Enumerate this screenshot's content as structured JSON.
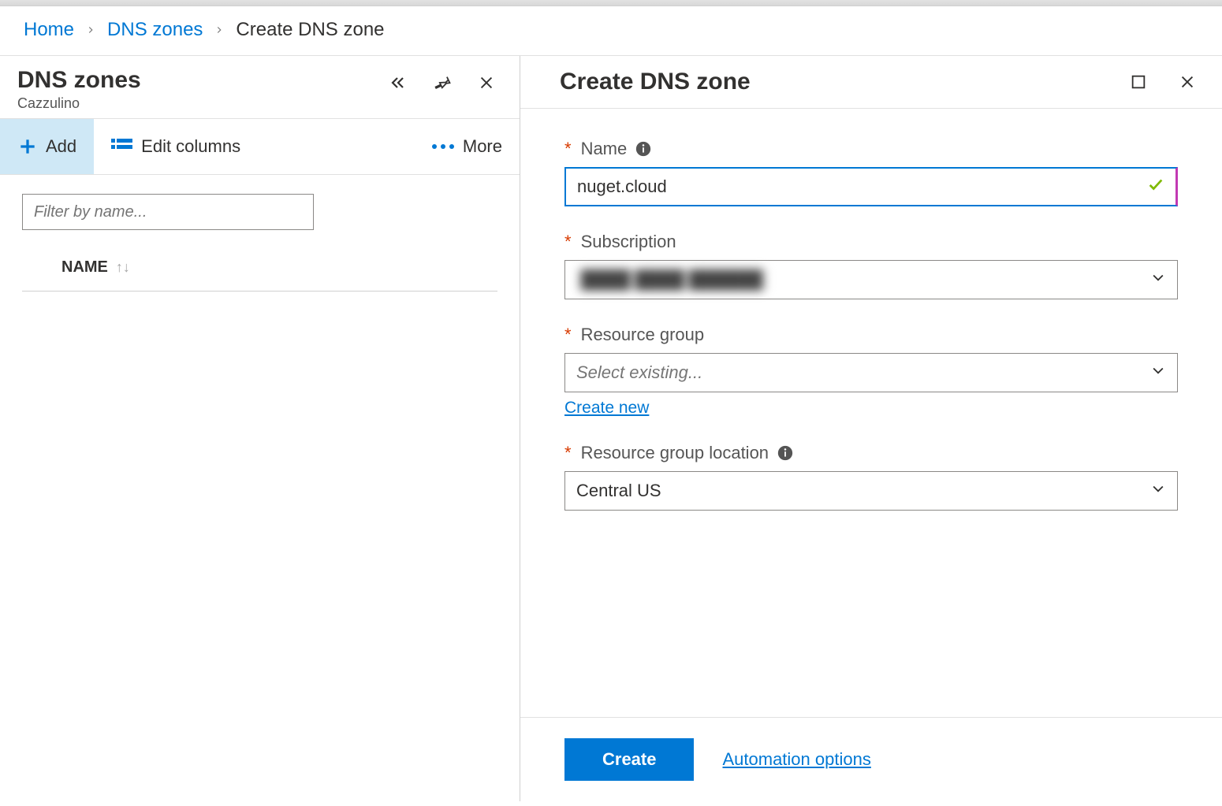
{
  "breadcrumb": {
    "home": "Home",
    "dns_zones": "DNS zones",
    "current": "Create DNS zone"
  },
  "left": {
    "title": "DNS zones",
    "subtitle": "Cazzulino",
    "toolbar": {
      "add": "Add",
      "edit_columns": "Edit columns",
      "more": "More"
    },
    "filter_placeholder": "Filter by name...",
    "list_header": "NAME"
  },
  "right": {
    "title": "Create DNS zone",
    "fields": {
      "name": {
        "label": "Name",
        "value": "nuget.cloud"
      },
      "subscription": {
        "label": "Subscription",
        "value": ""
      },
      "resource_group": {
        "label": "Resource group",
        "placeholder": "Select existing...",
        "create_new": "Create new"
      },
      "location": {
        "label": "Resource group location",
        "value": "Central US"
      }
    },
    "footer": {
      "create": "Create",
      "automation": "Automation options"
    }
  }
}
